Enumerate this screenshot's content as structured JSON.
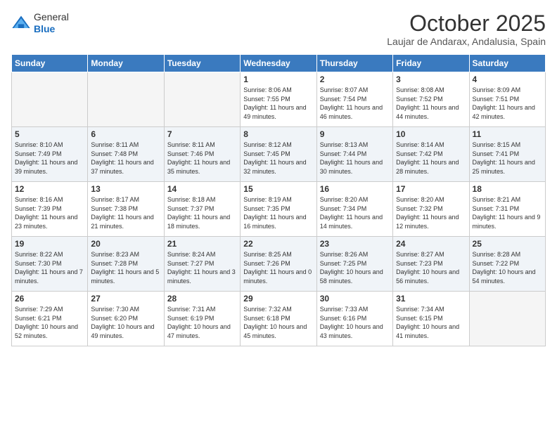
{
  "header": {
    "logo": {
      "general": "General",
      "blue": "Blue"
    },
    "title": "October 2025",
    "location": "Laujar de Andarax, Andalusia, Spain"
  },
  "weekdays": [
    "Sunday",
    "Monday",
    "Tuesday",
    "Wednesday",
    "Thursday",
    "Friday",
    "Saturday"
  ],
  "weeks": [
    {
      "shade": false,
      "days": [
        {
          "num": "",
          "empty": true
        },
        {
          "num": "",
          "empty": true
        },
        {
          "num": "",
          "empty": true
        },
        {
          "num": "1",
          "sunrise": "8:06 AM",
          "sunset": "7:55 PM",
          "daylight": "11 hours and 49 minutes."
        },
        {
          "num": "2",
          "sunrise": "8:07 AM",
          "sunset": "7:54 PM",
          "daylight": "11 hours and 46 minutes."
        },
        {
          "num": "3",
          "sunrise": "8:08 AM",
          "sunset": "7:52 PM",
          "daylight": "11 hours and 44 minutes."
        },
        {
          "num": "4",
          "sunrise": "8:09 AM",
          "sunset": "7:51 PM",
          "daylight": "11 hours and 42 minutes."
        }
      ]
    },
    {
      "shade": true,
      "days": [
        {
          "num": "5",
          "sunrise": "8:10 AM",
          "sunset": "7:49 PM",
          "daylight": "11 hours and 39 minutes."
        },
        {
          "num": "6",
          "sunrise": "8:11 AM",
          "sunset": "7:48 PM",
          "daylight": "11 hours and 37 minutes."
        },
        {
          "num": "7",
          "sunrise": "8:11 AM",
          "sunset": "7:46 PM",
          "daylight": "11 hours and 35 minutes."
        },
        {
          "num": "8",
          "sunrise": "8:12 AM",
          "sunset": "7:45 PM",
          "daylight": "11 hours and 32 minutes."
        },
        {
          "num": "9",
          "sunrise": "8:13 AM",
          "sunset": "7:44 PM",
          "daylight": "11 hours and 30 minutes."
        },
        {
          "num": "10",
          "sunrise": "8:14 AM",
          "sunset": "7:42 PM",
          "daylight": "11 hours and 28 minutes."
        },
        {
          "num": "11",
          "sunrise": "8:15 AM",
          "sunset": "7:41 PM",
          "daylight": "11 hours and 25 minutes."
        }
      ]
    },
    {
      "shade": false,
      "days": [
        {
          "num": "12",
          "sunrise": "8:16 AM",
          "sunset": "7:39 PM",
          "daylight": "11 hours and 23 minutes."
        },
        {
          "num": "13",
          "sunrise": "8:17 AM",
          "sunset": "7:38 PM",
          "daylight": "11 hours and 21 minutes."
        },
        {
          "num": "14",
          "sunrise": "8:18 AM",
          "sunset": "7:37 PM",
          "daylight": "11 hours and 18 minutes."
        },
        {
          "num": "15",
          "sunrise": "8:19 AM",
          "sunset": "7:35 PM",
          "daylight": "11 hours and 16 minutes."
        },
        {
          "num": "16",
          "sunrise": "8:20 AM",
          "sunset": "7:34 PM",
          "daylight": "11 hours and 14 minutes."
        },
        {
          "num": "17",
          "sunrise": "8:20 AM",
          "sunset": "7:32 PM",
          "daylight": "11 hours and 12 minutes."
        },
        {
          "num": "18",
          "sunrise": "8:21 AM",
          "sunset": "7:31 PM",
          "daylight": "11 hours and 9 minutes."
        }
      ]
    },
    {
      "shade": true,
      "days": [
        {
          "num": "19",
          "sunrise": "8:22 AM",
          "sunset": "7:30 PM",
          "daylight": "11 hours and 7 minutes."
        },
        {
          "num": "20",
          "sunrise": "8:23 AM",
          "sunset": "7:28 PM",
          "daylight": "11 hours and 5 minutes."
        },
        {
          "num": "21",
          "sunrise": "8:24 AM",
          "sunset": "7:27 PM",
          "daylight": "11 hours and 3 minutes."
        },
        {
          "num": "22",
          "sunrise": "8:25 AM",
          "sunset": "7:26 PM",
          "daylight": "11 hours and 0 minutes."
        },
        {
          "num": "23",
          "sunrise": "8:26 AM",
          "sunset": "7:25 PM",
          "daylight": "10 hours and 58 minutes."
        },
        {
          "num": "24",
          "sunrise": "8:27 AM",
          "sunset": "7:23 PM",
          "daylight": "10 hours and 56 minutes."
        },
        {
          "num": "25",
          "sunrise": "8:28 AM",
          "sunset": "7:22 PM",
          "daylight": "10 hours and 54 minutes."
        }
      ]
    },
    {
      "shade": false,
      "days": [
        {
          "num": "26",
          "sunrise": "7:29 AM",
          "sunset": "6:21 PM",
          "daylight": "10 hours and 52 minutes."
        },
        {
          "num": "27",
          "sunrise": "7:30 AM",
          "sunset": "6:20 PM",
          "daylight": "10 hours and 49 minutes."
        },
        {
          "num": "28",
          "sunrise": "7:31 AM",
          "sunset": "6:19 PM",
          "daylight": "10 hours and 47 minutes."
        },
        {
          "num": "29",
          "sunrise": "7:32 AM",
          "sunset": "6:18 PM",
          "daylight": "10 hours and 45 minutes."
        },
        {
          "num": "30",
          "sunrise": "7:33 AM",
          "sunset": "6:16 PM",
          "daylight": "10 hours and 43 minutes."
        },
        {
          "num": "31",
          "sunrise": "7:34 AM",
          "sunset": "6:15 PM",
          "daylight": "10 hours and 41 minutes."
        },
        {
          "num": "",
          "empty": true
        }
      ]
    }
  ]
}
